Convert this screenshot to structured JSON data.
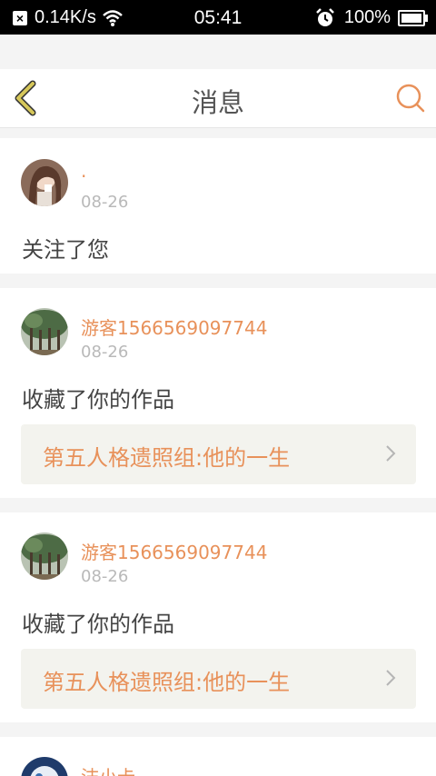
{
  "status_bar": {
    "speed": "0.14K/s",
    "time": "05:41",
    "battery": "100%"
  },
  "header": {
    "title": "消息"
  },
  "colors": {
    "accent": "#e8915a",
    "back_icon": "#c8b84a",
    "meta_gray": "#b9b9b9",
    "background": "#f4f4f4"
  },
  "messages": [
    {
      "user": "·",
      "date": "08-26",
      "action": "关注了您"
    },
    {
      "user": "游客1566569097744",
      "date": "08-26",
      "action": "收藏了你的作品",
      "work_title": "第五人格遗照组:他的一生"
    },
    {
      "user": "游客1566569097744",
      "date": "08-26",
      "action": "收藏了你的作品",
      "work_title": "第五人格遗照组:他的一生"
    },
    {
      "user": "沫小卡"
    }
  ],
  "icons": [
    "close-notification-icon",
    "wifi-icon",
    "alarm-icon",
    "battery-icon",
    "back-chevron-icon",
    "search-icon",
    "chevron-right-icon"
  ]
}
